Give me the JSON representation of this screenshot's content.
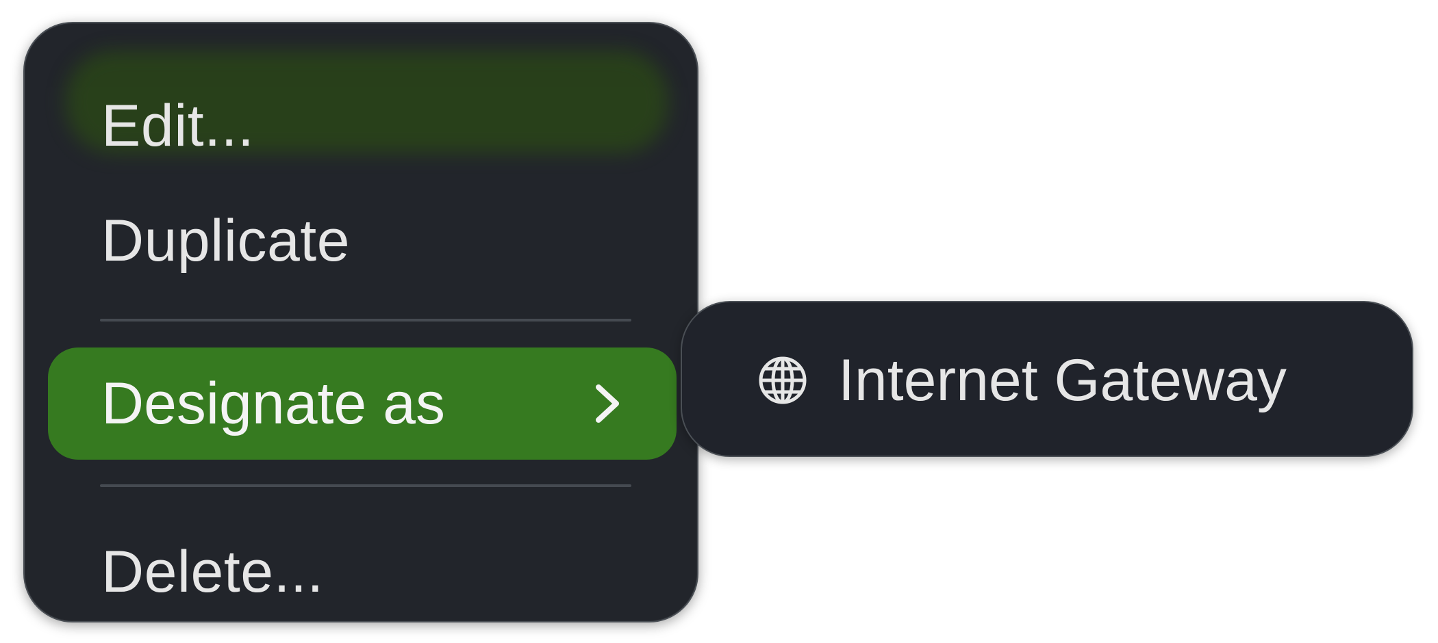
{
  "context_menu": {
    "items": [
      {
        "label": "Edit..."
      },
      {
        "label": "Duplicate"
      },
      {
        "label": "Designate as",
        "icon": "chevron-right-icon",
        "highlighted": true
      },
      {
        "label": "Delete..."
      }
    ]
  },
  "submenu": {
    "items": [
      {
        "label": "Internet Gateway",
        "icon": "globe-icon"
      }
    ]
  },
  "colors": {
    "menu_background": "#22252b",
    "highlight": "#367a20",
    "text": "#e6e6e6",
    "separator": "#454a51"
  }
}
